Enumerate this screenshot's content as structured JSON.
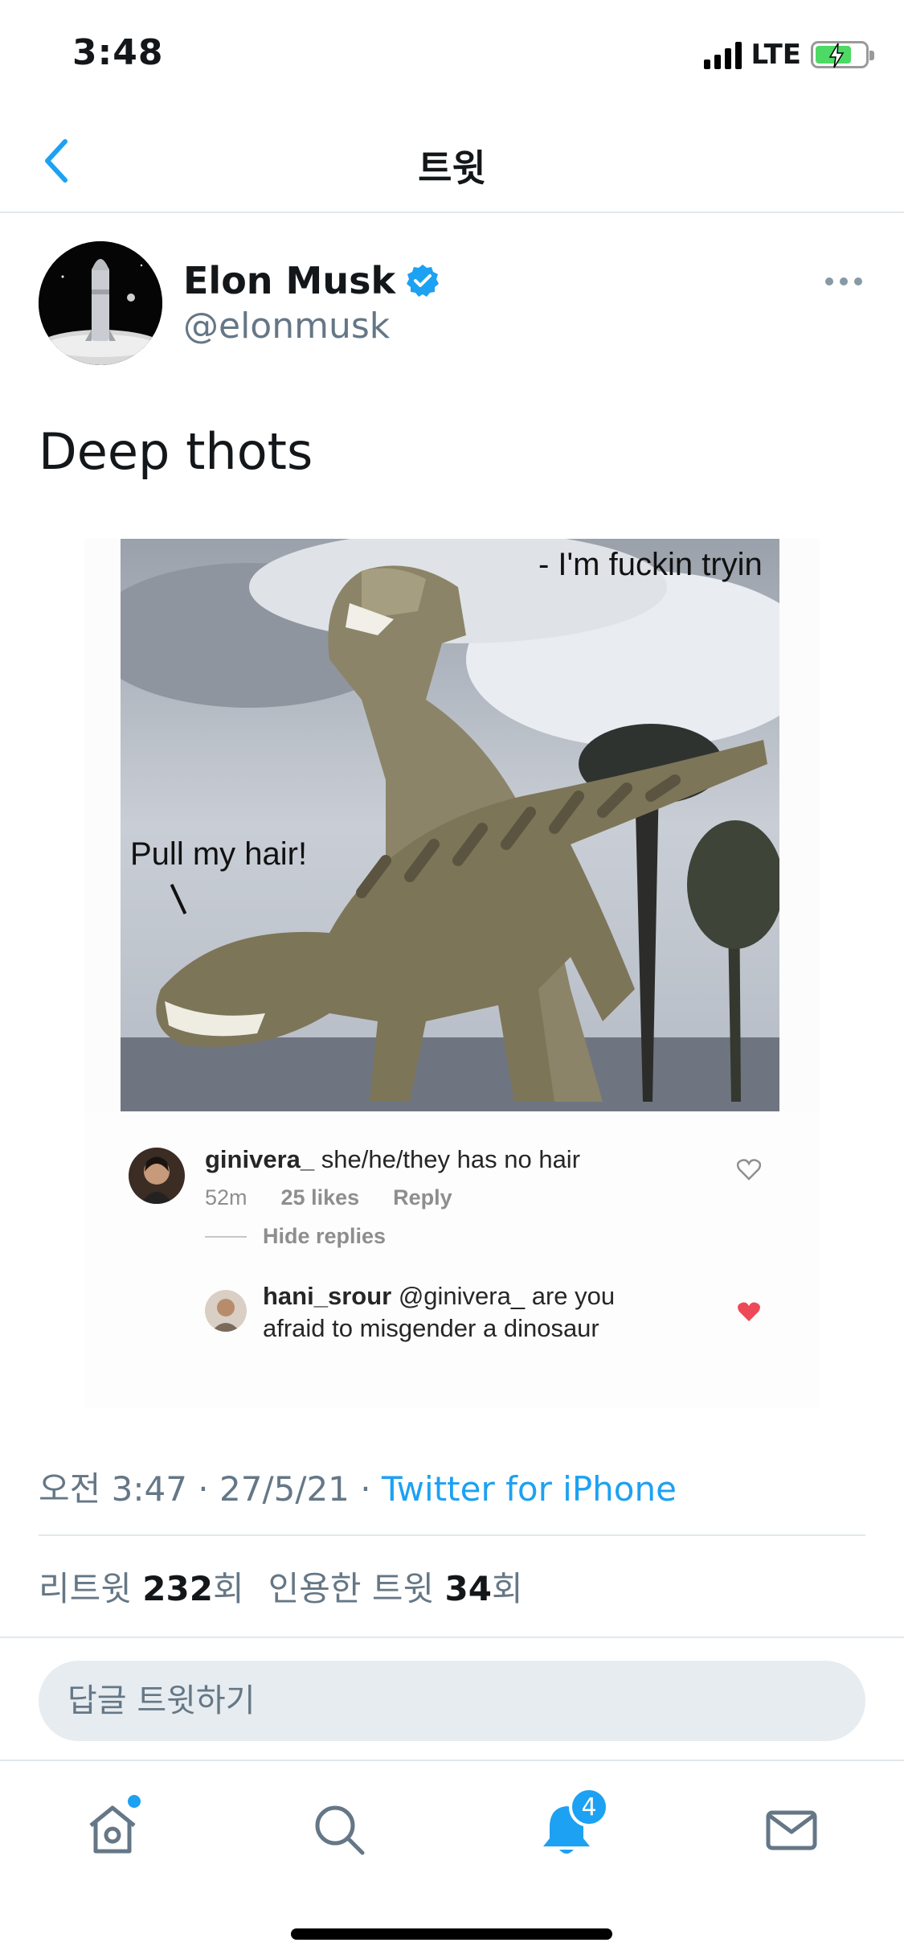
{
  "status_bar": {
    "time": "3:48",
    "network": "LTE"
  },
  "header": {
    "title": "트윗"
  },
  "tweet": {
    "author_name": "Elon Musk",
    "author_handle": "@elonmusk",
    "text": "Deep thots",
    "timestamp": "오전 3:47 · 27/5/21 · ",
    "source": "Twitter for iPhone",
    "retweets_label": "리트윗",
    "retweets_count": "232",
    "retweets_unit": "회",
    "quotes_label": "인용한 트윗",
    "quotes_count": "34",
    "quotes_unit": "회"
  },
  "media": {
    "caption_top": "- I'm fuckin tryin",
    "caption_left": "Pull my hair!",
    "comment1": {
      "user": "ginivera_",
      "text": " she/he/they has no hair",
      "time": "52m",
      "likes": "25 likes",
      "reply": "Reply"
    },
    "hide_replies": "Hide replies",
    "comment2": {
      "user": "hani_srour",
      "text_line1": " @ginivera_ are you",
      "text_line2": "afraid to misgender a dinosaur"
    }
  },
  "reply": {
    "placeholder": "답글 트윗하기"
  },
  "tabs": {
    "notifications_badge": "4"
  },
  "colors": {
    "accent": "#1da1f2",
    "secondary_text": "#657786",
    "divider": "#e1e8ed"
  }
}
